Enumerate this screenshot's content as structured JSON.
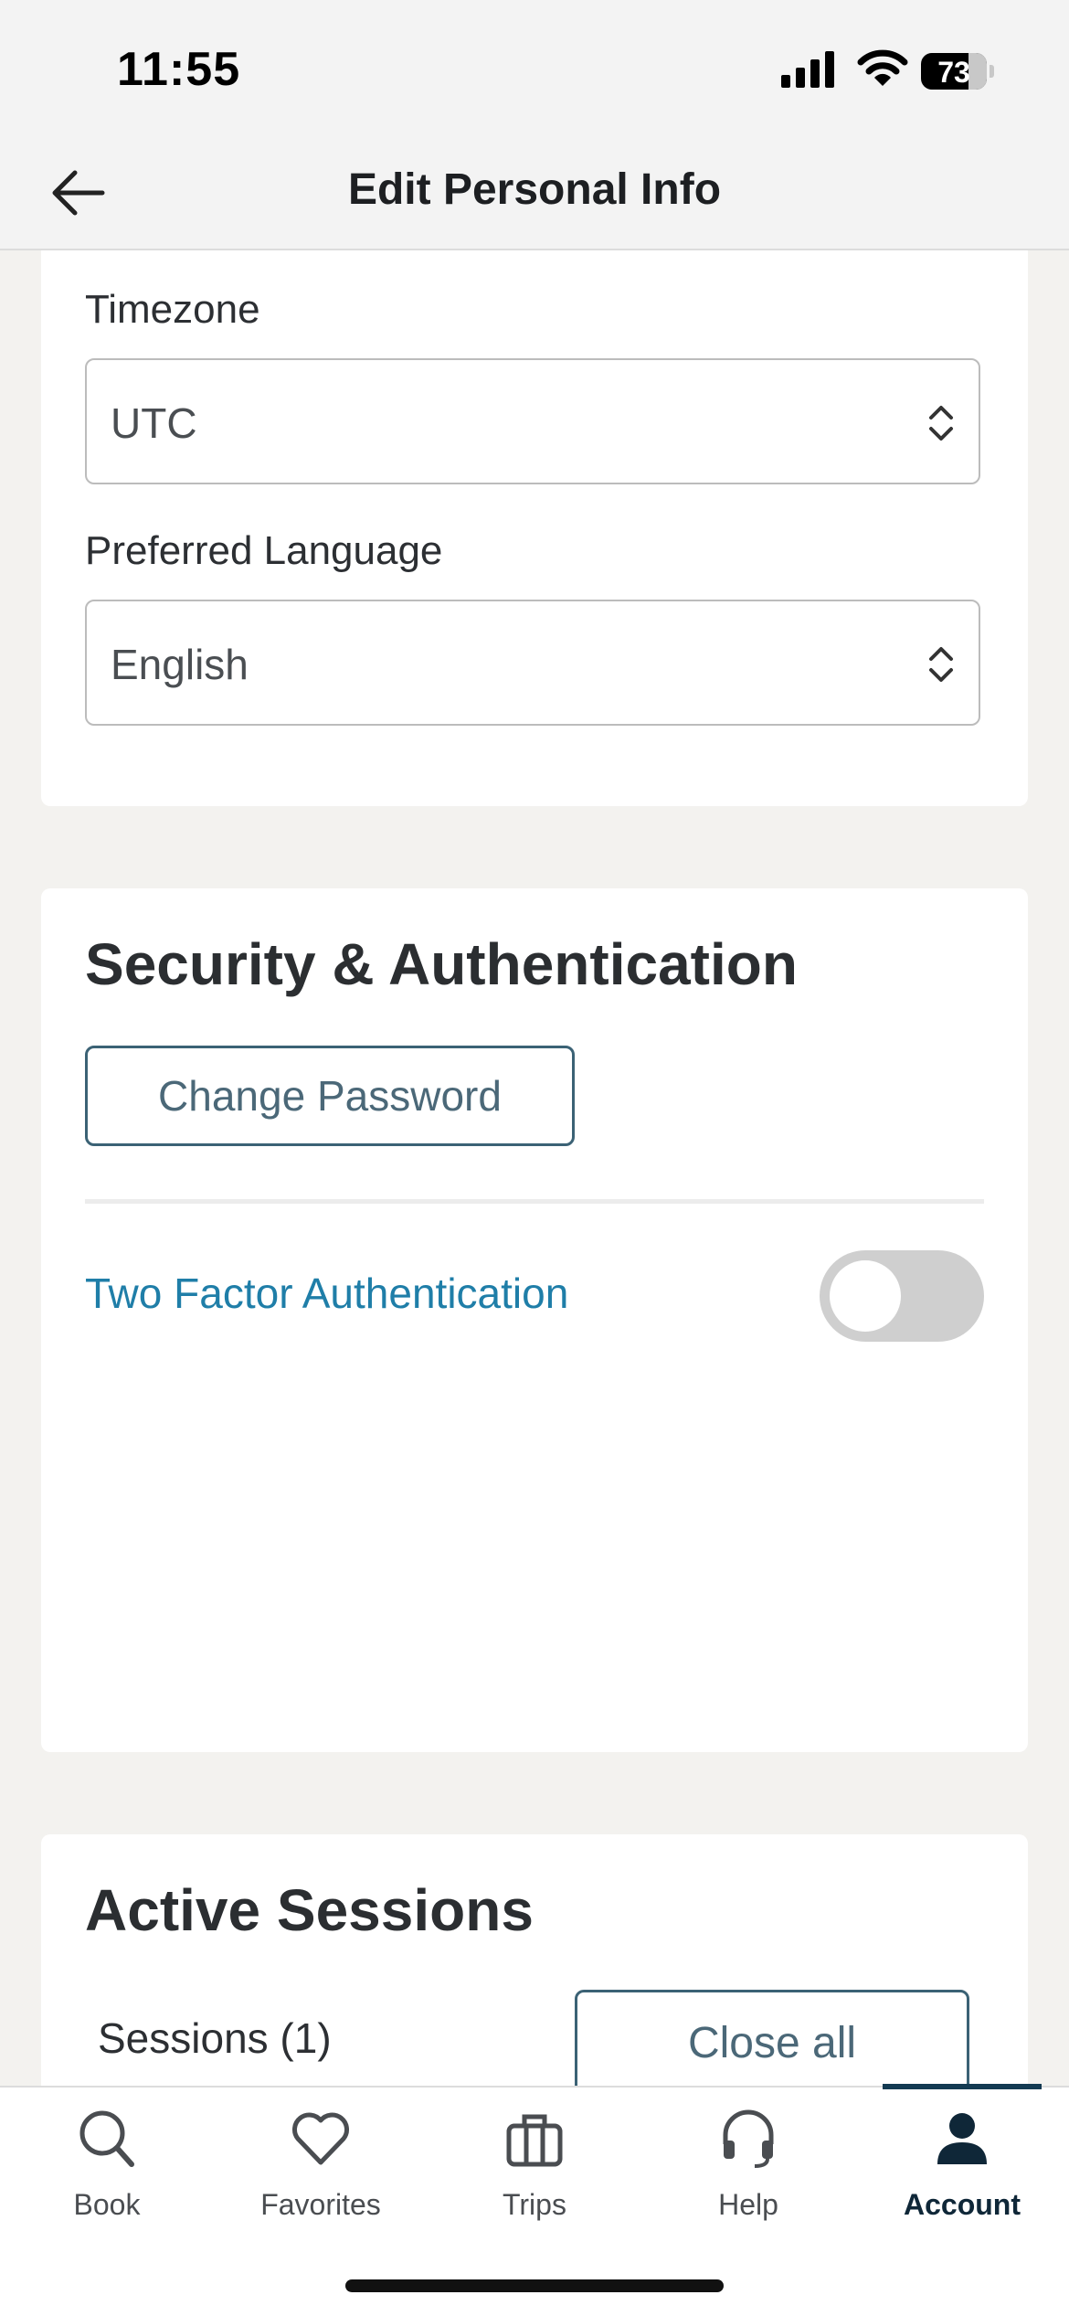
{
  "status": {
    "time": "11:55",
    "battery": "73"
  },
  "header": {
    "title": "Edit Personal Info"
  },
  "preferences": {
    "timezone_label": "Timezone",
    "timezone_value": "UTC",
    "language_label": "Preferred Language",
    "language_value": "English"
  },
  "security": {
    "title": "Security & Authentication",
    "change_password": "Change Password",
    "two_factor_label": "Two Factor Authentication",
    "two_factor_enabled": false
  },
  "sessions": {
    "title": "Active Sessions",
    "count_label": "Sessions (1)",
    "close_all": "Close all"
  },
  "tabs": [
    {
      "label": "Book",
      "icon": "search-icon"
    },
    {
      "label": "Favorites",
      "icon": "heart-icon"
    },
    {
      "label": "Trips",
      "icon": "briefcase-icon"
    },
    {
      "label": "Help",
      "icon": "headset-icon"
    },
    {
      "label": "Account",
      "icon": "person-icon",
      "active": true
    }
  ],
  "colors": {
    "accent": "#1f7ea8",
    "active_tab": "#133a52",
    "button_border": "#3b6275"
  }
}
